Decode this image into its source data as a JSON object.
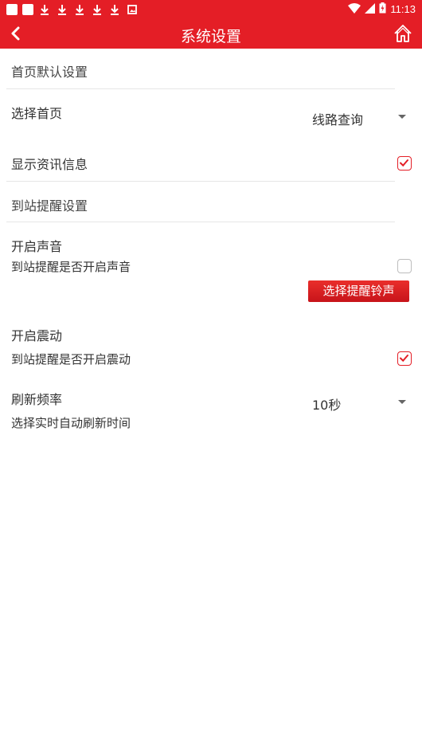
{
  "status_bar": {
    "time": "11:13",
    "icons": [
      "square-icon",
      "square-icon",
      "download-icon",
      "download-icon",
      "download-icon",
      "download-icon",
      "download-icon",
      "photo-icon",
      "wifi-icon",
      "signal-icon",
      "battery-icon"
    ]
  },
  "header": {
    "title": "系统设置",
    "accent_color": "#e41e26"
  },
  "settings": {
    "section_home": "首页默认设置",
    "choose_home_label": "选择首页",
    "choose_home_value": "线路查询",
    "show_news_label": "显示资讯信息",
    "show_news_checked": true,
    "section_arrival": "到站提醒设置",
    "sound_title": "开启声音",
    "sound_desc": "到站提醒是否开启声音",
    "sound_checked": false,
    "ringtone_button": "选择提醒铃声",
    "vibrate_title": "开启震动",
    "vibrate_desc": "到站提醒是否开启震动",
    "vibrate_checked": true,
    "refresh_title": "刷新频率",
    "refresh_value": "10秒",
    "refresh_desc": "选择实时自动刷新时间"
  }
}
